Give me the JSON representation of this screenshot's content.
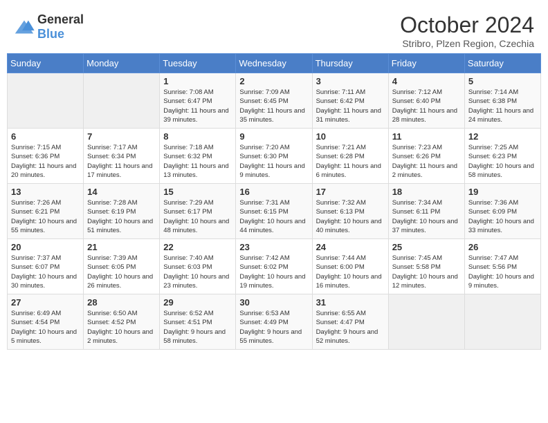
{
  "header": {
    "logo_general": "General",
    "logo_blue": "Blue",
    "month_title": "October 2024",
    "subtitle": "Stribro, Plzen Region, Czechia"
  },
  "weekdays": [
    "Sunday",
    "Monday",
    "Tuesday",
    "Wednesday",
    "Thursday",
    "Friday",
    "Saturday"
  ],
  "weeks": [
    [
      {
        "day": "",
        "info": ""
      },
      {
        "day": "",
        "info": ""
      },
      {
        "day": "1",
        "info": "Sunrise: 7:08 AM\nSunset: 6:47 PM\nDaylight: 11 hours and 39 minutes."
      },
      {
        "day": "2",
        "info": "Sunrise: 7:09 AM\nSunset: 6:45 PM\nDaylight: 11 hours and 35 minutes."
      },
      {
        "day": "3",
        "info": "Sunrise: 7:11 AM\nSunset: 6:42 PM\nDaylight: 11 hours and 31 minutes."
      },
      {
        "day": "4",
        "info": "Sunrise: 7:12 AM\nSunset: 6:40 PM\nDaylight: 11 hours and 28 minutes."
      },
      {
        "day": "5",
        "info": "Sunrise: 7:14 AM\nSunset: 6:38 PM\nDaylight: 11 hours and 24 minutes."
      }
    ],
    [
      {
        "day": "6",
        "info": "Sunrise: 7:15 AM\nSunset: 6:36 PM\nDaylight: 11 hours and 20 minutes."
      },
      {
        "day": "7",
        "info": "Sunrise: 7:17 AM\nSunset: 6:34 PM\nDaylight: 11 hours and 17 minutes."
      },
      {
        "day": "8",
        "info": "Sunrise: 7:18 AM\nSunset: 6:32 PM\nDaylight: 11 hours and 13 minutes."
      },
      {
        "day": "9",
        "info": "Sunrise: 7:20 AM\nSunset: 6:30 PM\nDaylight: 11 hours and 9 minutes."
      },
      {
        "day": "10",
        "info": "Sunrise: 7:21 AM\nSunset: 6:28 PM\nDaylight: 11 hours and 6 minutes."
      },
      {
        "day": "11",
        "info": "Sunrise: 7:23 AM\nSunset: 6:26 PM\nDaylight: 11 hours and 2 minutes."
      },
      {
        "day": "12",
        "info": "Sunrise: 7:25 AM\nSunset: 6:23 PM\nDaylight: 10 hours and 58 minutes."
      }
    ],
    [
      {
        "day": "13",
        "info": "Sunrise: 7:26 AM\nSunset: 6:21 PM\nDaylight: 10 hours and 55 minutes."
      },
      {
        "day": "14",
        "info": "Sunrise: 7:28 AM\nSunset: 6:19 PM\nDaylight: 10 hours and 51 minutes."
      },
      {
        "day": "15",
        "info": "Sunrise: 7:29 AM\nSunset: 6:17 PM\nDaylight: 10 hours and 48 minutes."
      },
      {
        "day": "16",
        "info": "Sunrise: 7:31 AM\nSunset: 6:15 PM\nDaylight: 10 hours and 44 minutes."
      },
      {
        "day": "17",
        "info": "Sunrise: 7:32 AM\nSunset: 6:13 PM\nDaylight: 10 hours and 40 minutes."
      },
      {
        "day": "18",
        "info": "Sunrise: 7:34 AM\nSunset: 6:11 PM\nDaylight: 10 hours and 37 minutes."
      },
      {
        "day": "19",
        "info": "Sunrise: 7:36 AM\nSunset: 6:09 PM\nDaylight: 10 hours and 33 minutes."
      }
    ],
    [
      {
        "day": "20",
        "info": "Sunrise: 7:37 AM\nSunset: 6:07 PM\nDaylight: 10 hours and 30 minutes."
      },
      {
        "day": "21",
        "info": "Sunrise: 7:39 AM\nSunset: 6:05 PM\nDaylight: 10 hours and 26 minutes."
      },
      {
        "day": "22",
        "info": "Sunrise: 7:40 AM\nSunset: 6:03 PM\nDaylight: 10 hours and 23 minutes."
      },
      {
        "day": "23",
        "info": "Sunrise: 7:42 AM\nSunset: 6:02 PM\nDaylight: 10 hours and 19 minutes."
      },
      {
        "day": "24",
        "info": "Sunrise: 7:44 AM\nSunset: 6:00 PM\nDaylight: 10 hours and 16 minutes."
      },
      {
        "day": "25",
        "info": "Sunrise: 7:45 AM\nSunset: 5:58 PM\nDaylight: 10 hours and 12 minutes."
      },
      {
        "day": "26",
        "info": "Sunrise: 7:47 AM\nSunset: 5:56 PM\nDaylight: 10 hours and 9 minutes."
      }
    ],
    [
      {
        "day": "27",
        "info": "Sunrise: 6:49 AM\nSunset: 4:54 PM\nDaylight: 10 hours and 5 minutes."
      },
      {
        "day": "28",
        "info": "Sunrise: 6:50 AM\nSunset: 4:52 PM\nDaylight: 10 hours and 2 minutes."
      },
      {
        "day": "29",
        "info": "Sunrise: 6:52 AM\nSunset: 4:51 PM\nDaylight: 9 hours and 58 minutes."
      },
      {
        "day": "30",
        "info": "Sunrise: 6:53 AM\nSunset: 4:49 PM\nDaylight: 9 hours and 55 minutes."
      },
      {
        "day": "31",
        "info": "Sunrise: 6:55 AM\nSunset: 4:47 PM\nDaylight: 9 hours and 52 minutes."
      },
      {
        "day": "",
        "info": ""
      },
      {
        "day": "",
        "info": ""
      }
    ]
  ]
}
